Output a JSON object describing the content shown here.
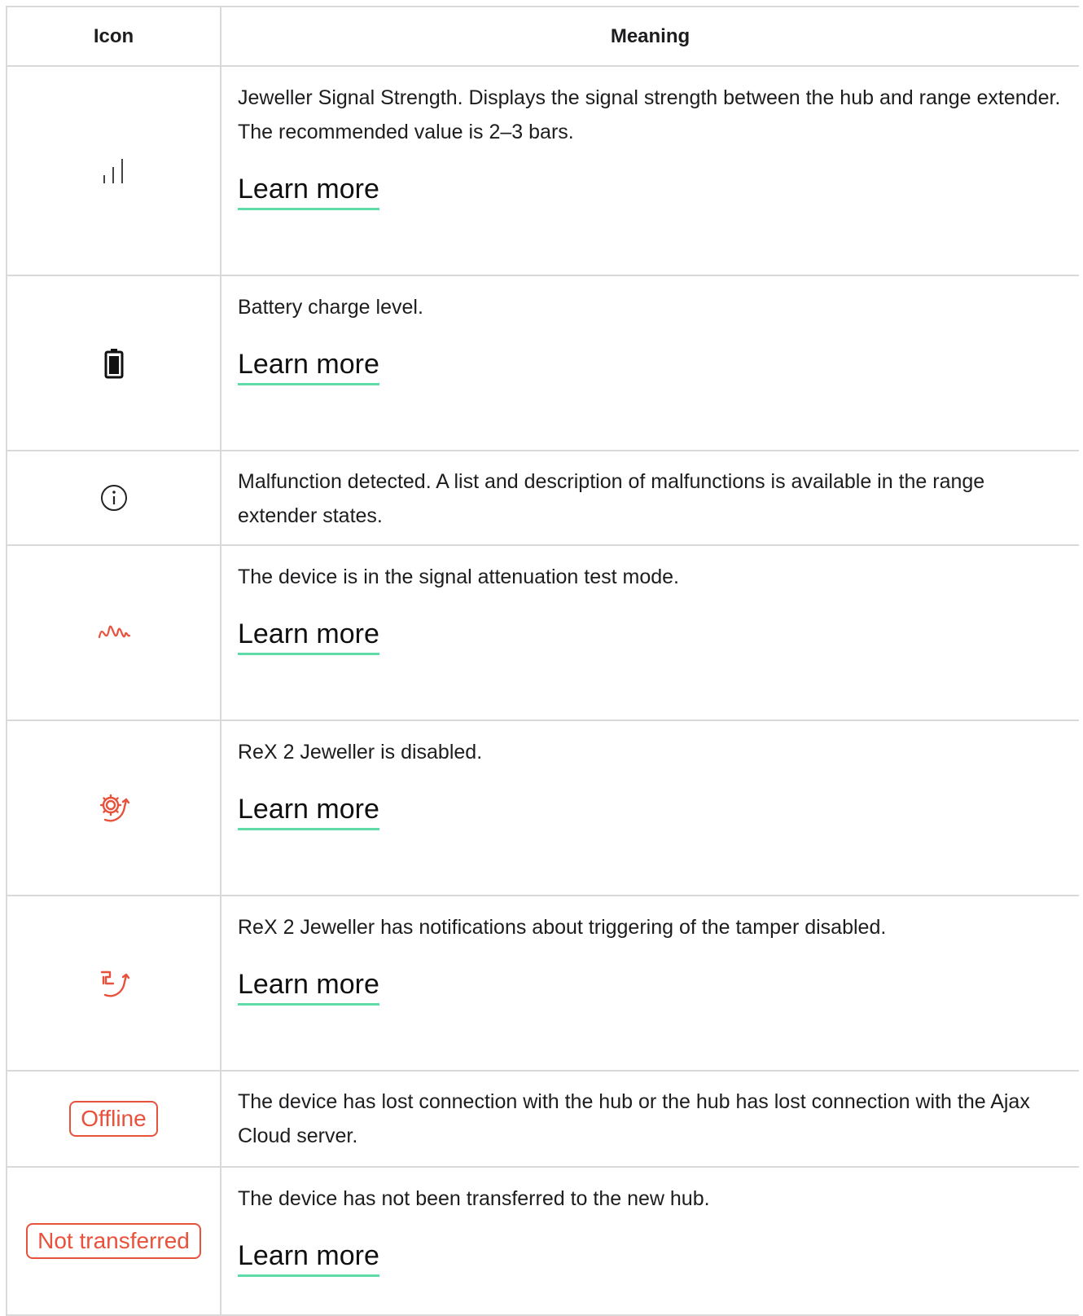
{
  "header": {
    "icon": "Icon",
    "meaning": "Meaning"
  },
  "rows": [
    {
      "icon": "signal-strength-icon",
      "description": "Jeweller Signal Strength. Displays the signal strength between the hub and range extender. The recommended value is 2–3 bars.",
      "link": "Learn more"
    },
    {
      "icon": "battery-icon",
      "description": "Battery charge level.",
      "link": "Learn more"
    },
    {
      "icon": "info-icon",
      "description": "Malfunction detected. A list and description of malfunctions is available in the range extender states."
    },
    {
      "icon": "attenuation-wave-icon",
      "description": "The device is in the signal attenuation test mode.",
      "link": "Learn more"
    },
    {
      "icon": "device-disabled-icon",
      "description": "ReX 2 Jeweller is disabled.",
      "link": "Learn more"
    },
    {
      "icon": "tamper-disabled-icon",
      "description": "ReX 2 Jeweller has notifications about triggering of the tamper disabled.",
      "link": "Learn more"
    },
    {
      "badge": "Offline",
      "description": "The device has lost connection with the hub or the hub has lost connection with the Ajax Cloud server."
    },
    {
      "badge": "Not transferred",
      "description": "The device has not been transferred to the new hub.",
      "link": "Learn more"
    }
  ],
  "colors": {
    "accent_underline": "#5fdba7",
    "status_red": "#e8513c",
    "border": "#d9d9d9"
  }
}
